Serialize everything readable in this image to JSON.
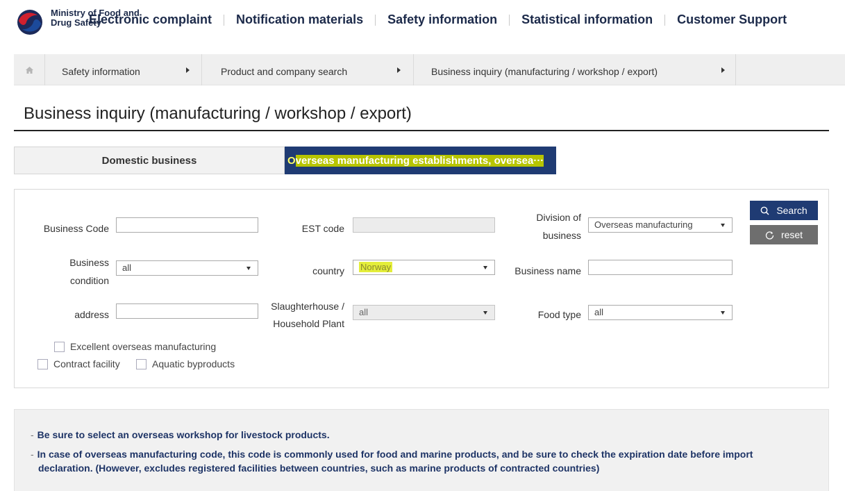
{
  "header": {
    "logo_text": "Ministry of Food and Drug Safety",
    "nav": [
      "Electronic complaint",
      "Notification materials",
      "Safety information",
      "Statistical information",
      "Customer Support"
    ]
  },
  "breadcrumb": {
    "items": [
      "Safety information",
      "Product and company search",
      "Business inquiry (manufacturing / workshop / export)"
    ]
  },
  "page": {
    "title": "Business inquiry (manufacturing / workshop / export)"
  },
  "tabs": {
    "domestic": "Domestic business",
    "overseas_first": "O",
    "overseas_rest": "verseas manufacturing establishments, oversea···"
  },
  "form": {
    "business_code_label": "Business Code",
    "est_code_label": "EST code",
    "division_label_1": "Division of",
    "division_label_2": "business",
    "division_value": "Overseas manufacturing",
    "business_condition_label_1": "Business",
    "business_condition_label_2": "condition",
    "business_condition_value": "all",
    "country_label": "country",
    "country_value": "Norway",
    "business_name_label": "Business name",
    "address_label": "address",
    "slaughterhouse_label_1": "Slaughterhouse /",
    "slaughterhouse_label_2": "Household Plant",
    "slaughterhouse_value": "all",
    "food_type_label": "Food type",
    "food_type_value": "all",
    "search_button": "Search",
    "reset_button": "reset",
    "check_excellent": "Excellent overseas manufacturing",
    "check_contract": "Contract facility",
    "check_aquatic": "Aquatic byproducts"
  },
  "notice": {
    "dash": "-",
    "line1": "Be sure to select an overseas workshop for livestock products.",
    "line2a": "In case of overseas manufacturing code, this code is commonly used for food and marine products, and be sure to check the expiration date before import",
    "line2b": "declaration. (However, excludes registered facilities between countries, such as marine products of contracted countries)"
  },
  "colors": {
    "navy": "#1f3b73",
    "highlight": "#e4ee3a",
    "gray_button": "#6e6e6e"
  }
}
